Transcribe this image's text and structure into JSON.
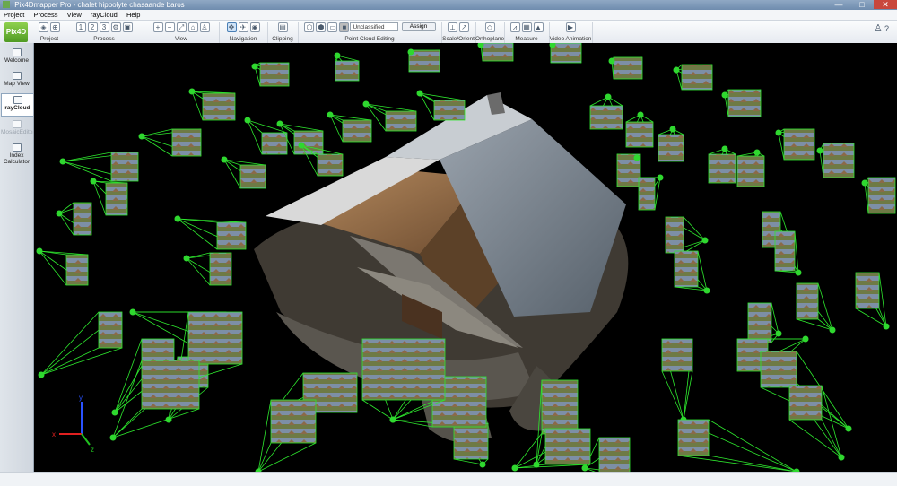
{
  "window": {
    "title": "Pix4Dmapper Pro - chalet hippolyte chasaande baros",
    "controls": [
      "—",
      "□",
      "✕"
    ]
  },
  "menu": [
    "Project",
    "Process",
    "View",
    "rayCloud",
    "Help"
  ],
  "toolbar": {
    "groups": [
      {
        "label": "Project",
        "icons": [
          "open-project-icon",
          "target-icon"
        ]
      },
      {
        "label": "Process",
        "icons": [
          "process-step1-icon",
          "process-step2-icon",
          "process-step3-icon",
          "process-options-icon",
          "process-lock-icon"
        ]
      },
      {
        "label": "View",
        "icons": [
          "zoom-in-icon",
          "zoom-out-icon",
          "fit-view-icon",
          "home-view-icon",
          "person-view-icon"
        ]
      },
      {
        "label": "Navigation",
        "icons": [
          "trackball-icon",
          "first-person-icon",
          "eye-icon"
        ]
      },
      {
        "label": "Clipping",
        "icons": [
          "clip-box-icon"
        ]
      },
      {
        "label": "Point Cloud Editing",
        "icons": [
          "cube-icon",
          "cube-edit-icon",
          "select-icon",
          "class-color-icon"
        ]
      },
      {
        "label": "Scale/Orient",
        "icons": [
          "scale-icon",
          "orient-icon"
        ]
      },
      {
        "label": "Orthoplane",
        "icons": [
          "orthoplane-icon"
        ]
      },
      {
        "label": "Measure",
        "icons": [
          "polyline-icon",
          "surface-icon",
          "volume-icon"
        ]
      },
      {
        "label": "Video Animation",
        "icons": [
          "video-camera-icon"
        ]
      }
    ],
    "classification_value": "Unclassified",
    "assign_label": "Assign"
  },
  "sidebar": {
    "logo": "Pix4D",
    "items": [
      {
        "label": "Welcome",
        "icon": "home-icon",
        "state": "normal"
      },
      {
        "label": "Map View",
        "icon": "map-icon",
        "state": "normal"
      },
      {
        "label": "rayCloud",
        "icon": "raycloud-icon",
        "state": "active"
      },
      {
        "label": "MosaicEditor",
        "icon": "mosaic-icon",
        "state": "disabled"
      },
      {
        "label": "Index Calculator",
        "icon": "index-calc-icon",
        "state": "normal"
      }
    ]
  },
  "colors": {
    "camera_ray": "#2ee82e",
    "camera_dot": "#2fd82f",
    "axis_x": "#e02020",
    "axis_y": "#2a52ff",
    "axis_z": "#20c020"
  },
  "viewport": {
    "axis_labels": {
      "x": "x",
      "y": "y",
      "z": "z"
    }
  }
}
